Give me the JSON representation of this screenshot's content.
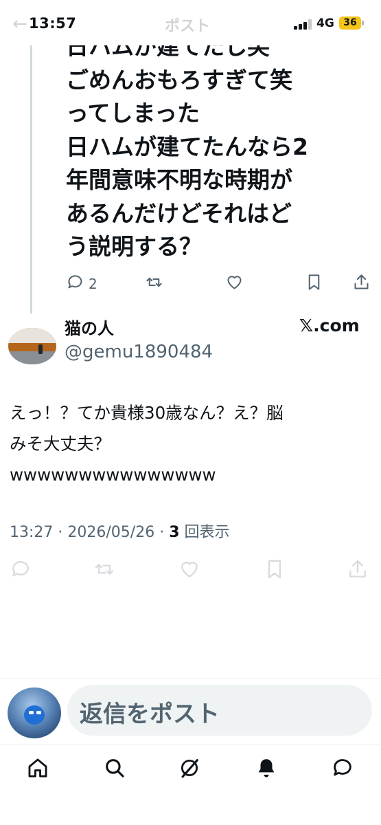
{
  "status_bar": {
    "time": "13:57",
    "network": "4G",
    "battery": "36"
  },
  "header": {
    "back_glyph": "←",
    "title": "ポスト"
  },
  "previous_post": {
    "text": "日ハムが建てたし笑\nごめんおもろすぎて笑\nってしまった\n日ハムが建てたんなら2\n年間意味不明な時期が\nあるんだけどそれはど\nう説明する？",
    "reply_count": "2",
    "icons": [
      "reply-icon",
      "repost-icon",
      "like-icon",
      "bookmark-icon",
      "share-icon"
    ]
  },
  "post": {
    "display_name": "猫の人",
    "handle": "@gemu1890484",
    "source": "𝕏.com",
    "text": "えっ！？てか貴様30歳なん？え？脳\nみそ大丈夫？\nwwwwwwwwwwwwwww",
    "time": "13:27",
    "date": "2026/05/26",
    "views_count": "3",
    "views_label": "回表示",
    "icons": [
      "reply-icon",
      "repost-icon",
      "like-icon",
      "bookmark-icon",
      "share-icon"
    ]
  },
  "reply": {
    "placeholder": "返信をポスト"
  },
  "bottom_nav": [
    "home-icon",
    "search-icon",
    "grok-icon",
    "notifications-icon",
    "messages-icon"
  ],
  "colors": {
    "text": "#0f1419",
    "muted": "#536471",
    "divider": "#cfd9de",
    "battery": "#f5c518"
  }
}
